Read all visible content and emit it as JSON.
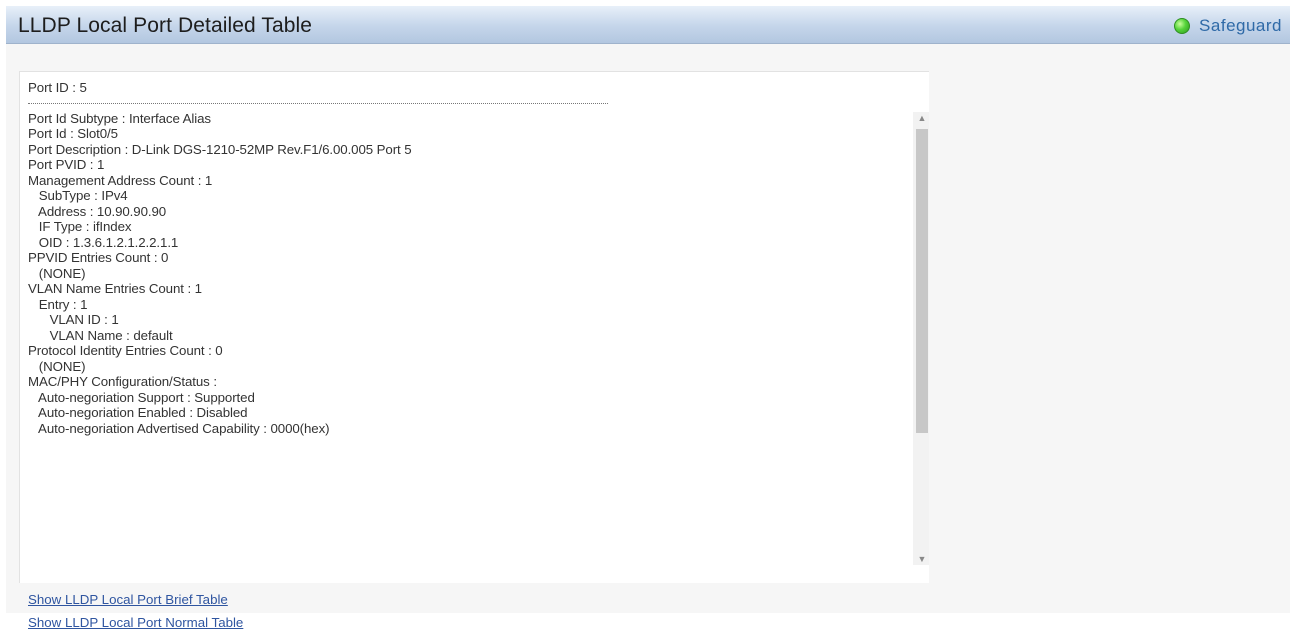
{
  "header": {
    "title": "LLDP Local Port Detailed Table",
    "status_label": "Safeguard",
    "status_color": "#55d33a"
  },
  "detail": {
    "lines": [
      "Port ID : 5",
      "---separator---",
      "Port Id Subtype : Interface Alias",
      "Port Id : Slot0/5",
      "Port Description : D-Link DGS-1210-52MP Rev.F1/6.00.005 Port 5",
      "Port PVID : 1",
      "Management Address Count : 1",
      "   SubType : IPv4",
      "   Address : 10.90.90.90",
      "   IF Type : ifIndex",
      "   OID : 1.3.6.1.2.1.2.2.1.1",
      "PPVID Entries Count : 0",
      "   (NONE)",
      "VLAN Name Entries Count : 1",
      "   Entry : 1",
      "      VLAN ID : 1",
      "      VLAN Name : default",
      "Protocol Identity Entries Count : 0",
      "   (NONE)",
      "MAC/PHY Configuration/Status :",
      "   Auto-negoriation Support : Supported",
      "   Auto-negoriation Enabled : Disabled",
      "   Auto-negoriation Advertised Capability : 0000(hex)"
    ]
  },
  "links": {
    "brief": "Show LLDP Local Port Brief Table",
    "normal": "Show LLDP Local Port Normal Table"
  },
  "icons": {
    "status": "green-led-icon",
    "scroll_up": "arrow-up-icon",
    "scroll_down": "arrow-down-icon",
    "scroll_left": "arrow-left-icon",
    "scroll_right": "arrow-right-icon"
  }
}
